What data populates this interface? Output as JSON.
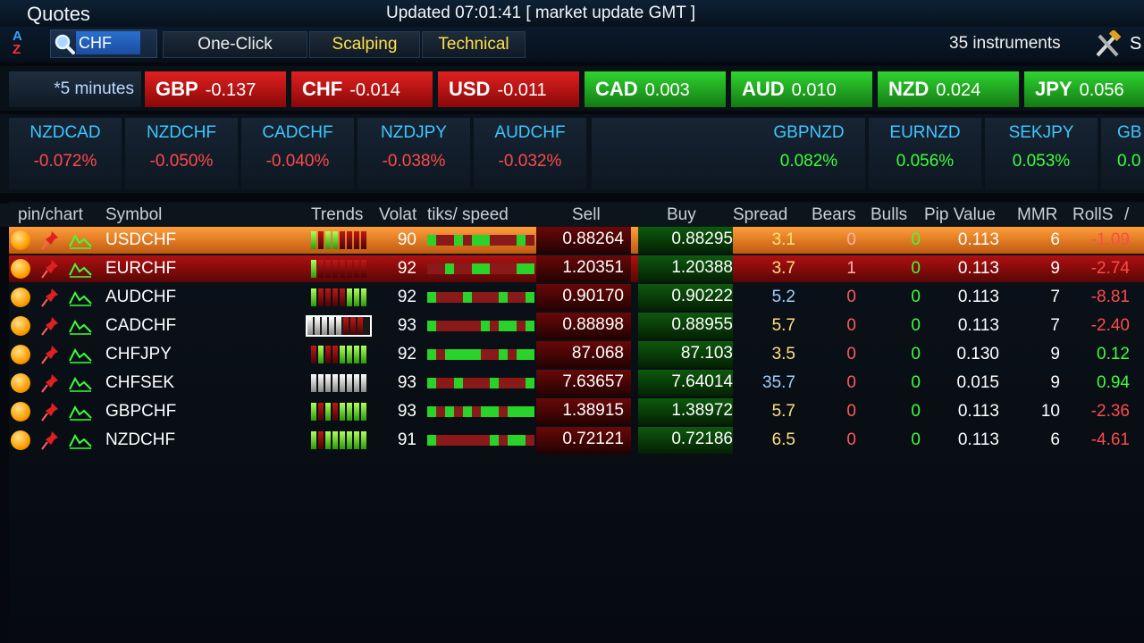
{
  "window": {
    "title": "Quotes",
    "updated": "Updated 07:01:41  [ market update  GMT ]"
  },
  "toolbar": {
    "search_value": "CHF",
    "one_click": "One-Click",
    "scalping": "Scalping",
    "technical": "Technical",
    "instruments": "35 instruments",
    "tools_label": "S"
  },
  "strength": {
    "period": "*5 minutes",
    "currencies": [
      {
        "code": "GBP",
        "value": "-0.137"
      },
      {
        "code": "CHF",
        "value": "-0.014"
      },
      {
        "code": "USD",
        "value": "-0.011"
      },
      {
        "code": "CAD",
        "value": "0.003"
      },
      {
        "code": "AUD",
        "value": "0.010"
      },
      {
        "code": "NZD",
        "value": "0.024"
      },
      {
        "code": "JPY",
        "value": "0.056"
      }
    ]
  },
  "pairs": [
    {
      "name": "NZDCAD",
      "value": "-0.072%"
    },
    {
      "name": "NZDCHF",
      "value": "-0.050%"
    },
    {
      "name": "CADCHF",
      "value": "-0.040%"
    },
    {
      "name": "NZDJPY",
      "value": "-0.038%"
    },
    {
      "name": "AUDCHF",
      "value": "-0.032%"
    },
    {
      "name": "GBPNZD",
      "value": "0.082%"
    },
    {
      "name": "EURNZD",
      "value": "0.056%"
    },
    {
      "name": "SEKJPY",
      "value": "0.053%"
    },
    {
      "name": "GB",
      "value": "0.0"
    }
  ],
  "columns": {
    "pin_chart": "pin/chart",
    "symbol": "Symbol",
    "trends": "Trends",
    "volat": "Volat",
    "speed": "tiks/ speed",
    "sell": "Sell",
    "buy": "Buy",
    "spread": "Spread",
    "bears": "Bears",
    "bulls": "Bulls",
    "pip": "Pip Value",
    "mmr": "MMR",
    "rolls": "RollS",
    "rolls_b": "/"
  },
  "rows": [
    {
      "symbol": "USDCHF",
      "volat": "90",
      "sell": "0.88264",
      "buy": "0.88295",
      "spread": "3.1",
      "bears": "0",
      "bulls": "0",
      "pip": "0.113",
      "mmr": "6",
      "rolls": "-1.09"
    },
    {
      "symbol": "EURCHF",
      "volat": "92",
      "sell": "1.20351",
      "buy": "1.20388",
      "spread": "3.7",
      "bears": "1",
      "bulls": "0",
      "pip": "0.113",
      "mmr": "9",
      "rolls": "-2.74"
    },
    {
      "symbol": "AUDCHF",
      "volat": "92",
      "sell": "0.90170",
      "buy": "0.90222",
      "spread": "5.2",
      "bears": "0",
      "bulls": "0",
      "pip": "0.113",
      "mmr": "7",
      "rolls": "-8.81"
    },
    {
      "symbol": "CADCHF",
      "volat": "93",
      "sell": "0.88898",
      "buy": "0.88955",
      "spread": "5.7",
      "bears": "0",
      "bulls": "0",
      "pip": "0.113",
      "mmr": "7",
      "rolls": "-2.40"
    },
    {
      "symbol": "CHFJPY",
      "volat": "92",
      "sell": "87.068",
      "buy": "87.103",
      "spread": "3.5",
      "bears": "0",
      "bulls": "0",
      "pip": "0.130",
      "mmr": "9",
      "rolls": "0.12"
    },
    {
      "symbol": "CHFSEK",
      "volat": "93",
      "sell": "7.63657",
      "buy": "7.64014",
      "spread": "35.7",
      "bears": "0",
      "bulls": "0",
      "pip": "0.015",
      "mmr": "9",
      "rolls": "0.94"
    },
    {
      "symbol": "GBPCHF",
      "volat": "93",
      "sell": "1.38915",
      "buy": "1.38972",
      "spread": "5.7",
      "bears": "0",
      "bulls": "0",
      "pip": "0.113",
      "mmr": "10",
      "rolls": "-2.36"
    },
    {
      "symbol": "NZDCHF",
      "volat": "91",
      "sell": "0.72121",
      "buy": "0.72186",
      "spread": "6.5",
      "bears": "0",
      "bulls": "0",
      "pip": "0.113",
      "mmr": "6",
      "rolls": "-4.61"
    }
  ]
}
